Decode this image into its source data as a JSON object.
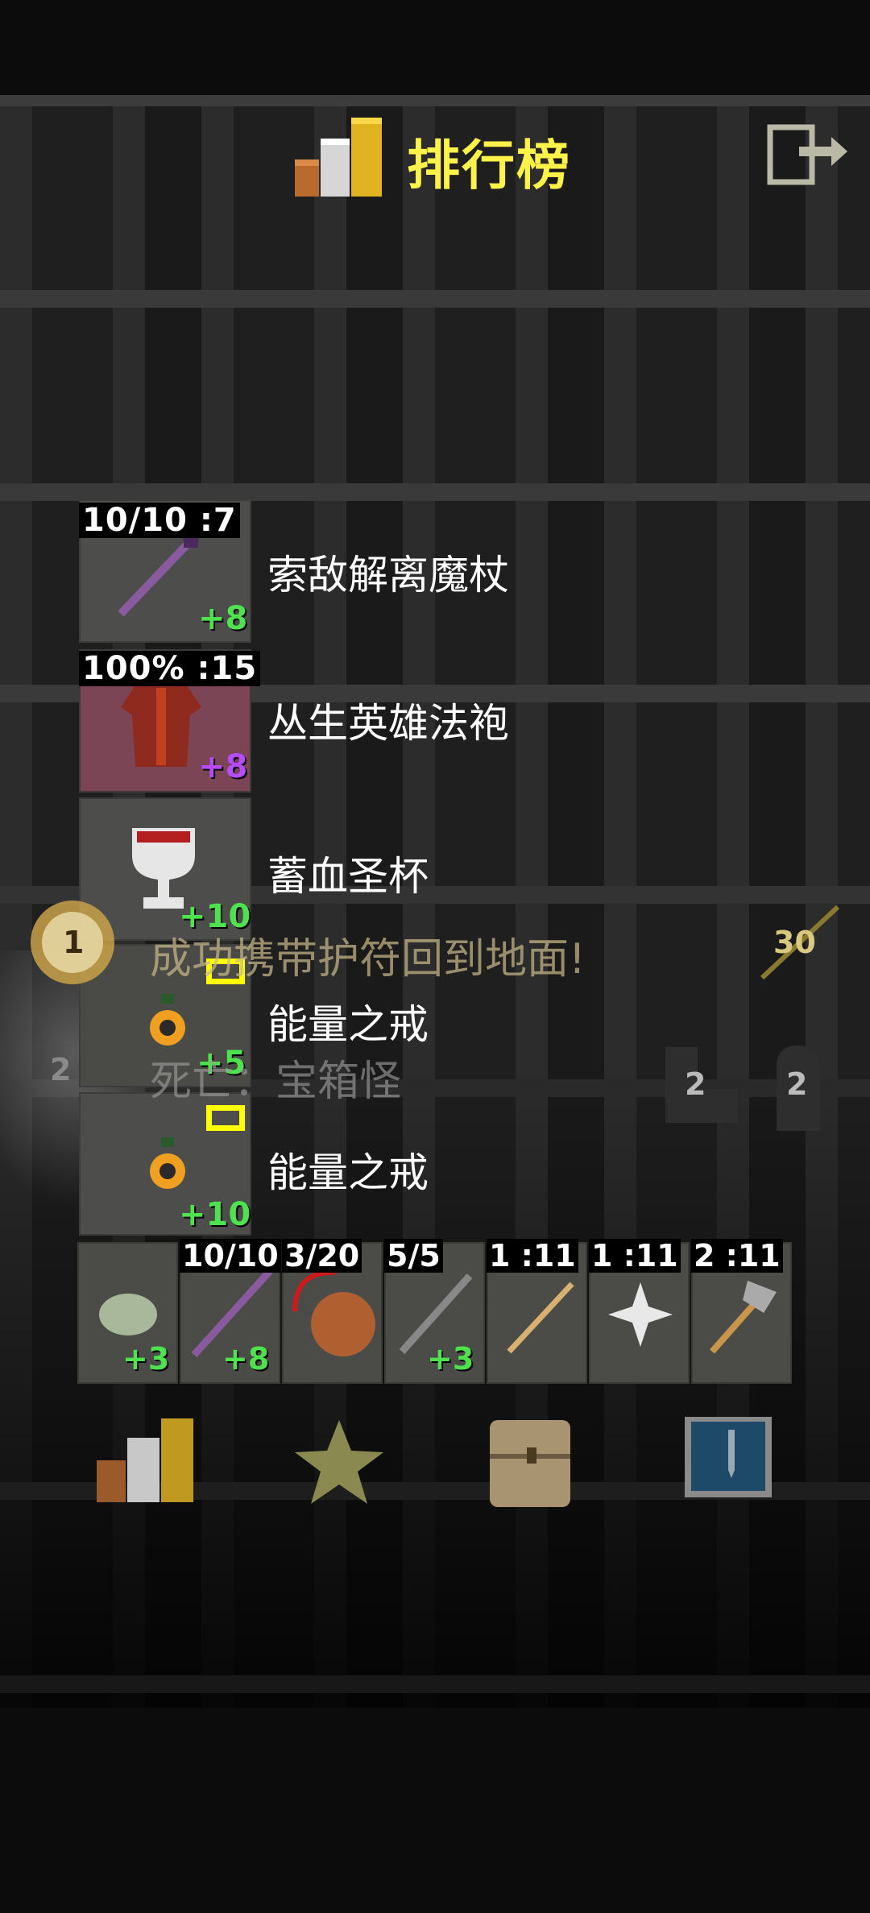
{
  "header": {
    "title": "排行榜",
    "exit_icon": "exit-icon"
  },
  "items": [
    {
      "top_label": "10/10 :7",
      "plus": "+8",
      "name": "索敌解离魔杖",
      "plus_color": "#4ee34e"
    },
    {
      "top_label": "100% :15",
      "plus": "+8",
      "name": "丛生英雄法袍",
      "plus_color": "#b54dff"
    },
    {
      "top_label": "",
      "plus": "+10",
      "name": "蓄血圣杯",
      "plus_color": "#4ee34e"
    },
    {
      "top_label": "",
      "plus": "+5",
      "name": "能量之戒",
      "plus_color": "#4ee34e"
    },
    {
      "top_label": "",
      "plus": "+10",
      "name": "能量之戒",
      "plus_color": "#4ee34e"
    }
  ],
  "overlay": {
    "banner": "成功携带护符回到地面!",
    "death": "死亡：宝箱怪",
    "rank_badge": "1",
    "depth": "30",
    "left_count": "2",
    "right_count_a": "2",
    "right_count_b": "2"
  },
  "quickslots": [
    {
      "top": "",
      "plus": "+3"
    },
    {
      "top": "10/10",
      "plus": "+8"
    },
    {
      "top": "3/20",
      "plus": ""
    },
    {
      "top": "5/5",
      "plus": "+3"
    },
    {
      "top": "1 :11",
      "plus": ""
    },
    {
      "top": "1 :11",
      "plus": ""
    },
    {
      "top": "2 :11",
      "plus": ""
    }
  ],
  "toolbar": {
    "rankings_icon": "rankings-icon",
    "badges_icon": "star-icon",
    "backpack_icon": "backpack-icon",
    "journal_icon": "journal-icon"
  }
}
